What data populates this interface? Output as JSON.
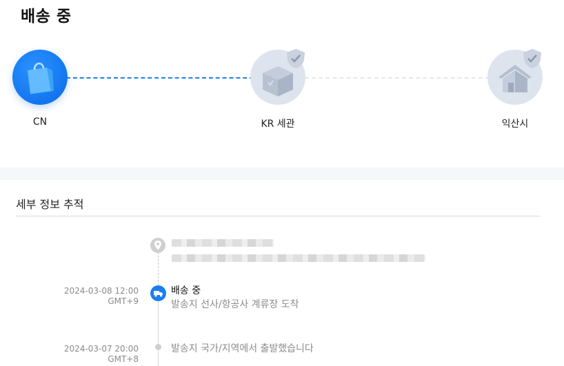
{
  "header": {
    "status_title": "배송 중"
  },
  "route": {
    "nodes": [
      {
        "label": "CN",
        "icon": "shopping-bag-icon",
        "state": "done"
      },
      {
        "label": "KR 세관",
        "icon": "package-box-icon",
        "state": "pending"
      },
      {
        "label": "익산시",
        "icon": "house-icon",
        "state": "pending"
      }
    ],
    "colors": {
      "active": "#1a7ff0",
      "pending": "#dde4ee"
    }
  },
  "details": {
    "title": "세부 정보 추적",
    "events": [
      {
        "time": "2024-03-08 12:00",
        "tz": "GMT+9",
        "status": "배송 중",
        "description": "발송지 선사/항공사 계류장 도착",
        "icon": "truck-icon"
      },
      {
        "time": "2024-03-07 20:00",
        "tz": "GMT+8",
        "status": "",
        "description": "발송지 국가/지역에서 출발했습니다",
        "icon": "dot-icon"
      }
    ]
  }
}
